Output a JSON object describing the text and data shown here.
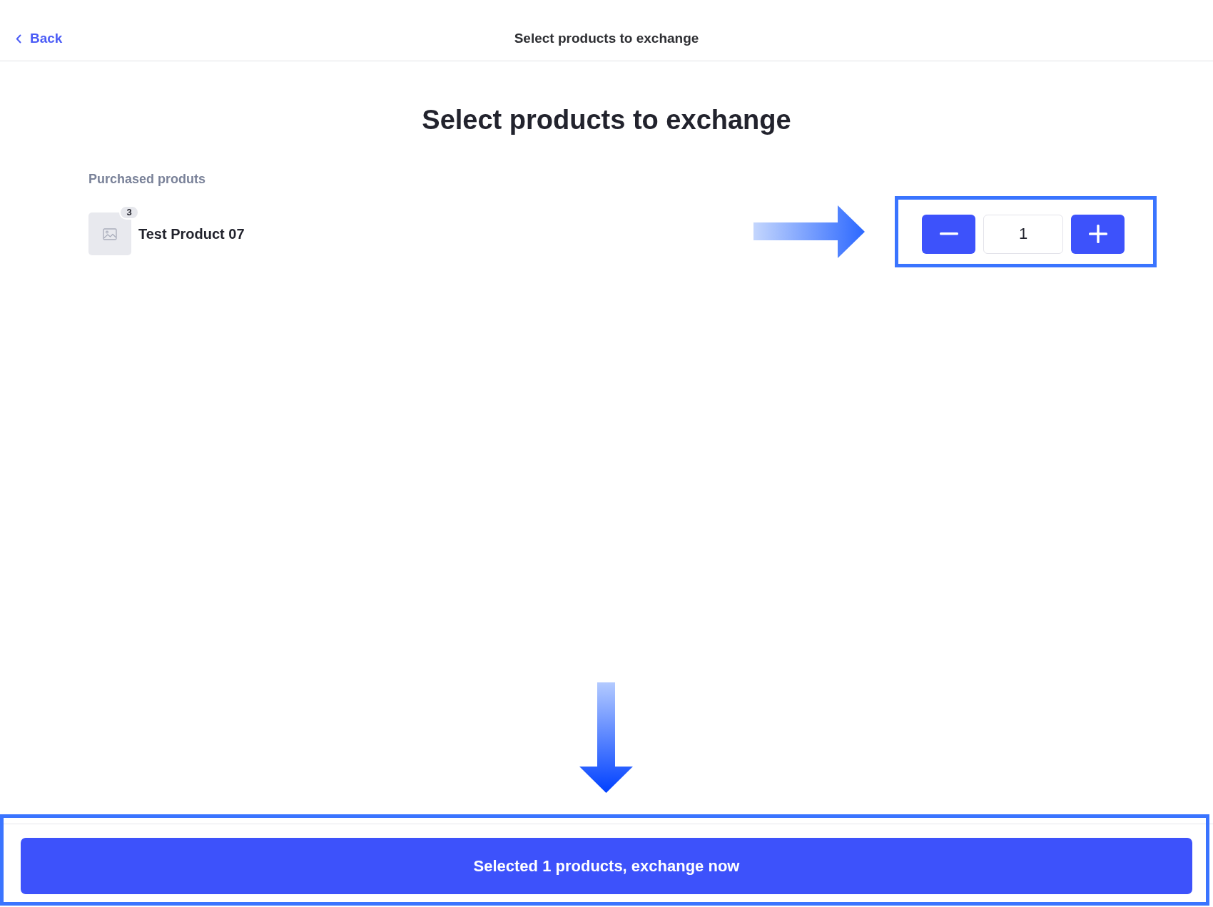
{
  "header": {
    "back_label": "Back",
    "title": "Select products to exchange"
  },
  "heading": "Select products to exchange",
  "section_label": "Purchased produts",
  "products": [
    {
      "name": "Test Product 07",
      "purchased_count": "3",
      "quantity": "1",
      "highlighted": true
    }
  ],
  "footer": {
    "button_label": "Selected 1 products, exchange now",
    "highlighted": true
  }
}
